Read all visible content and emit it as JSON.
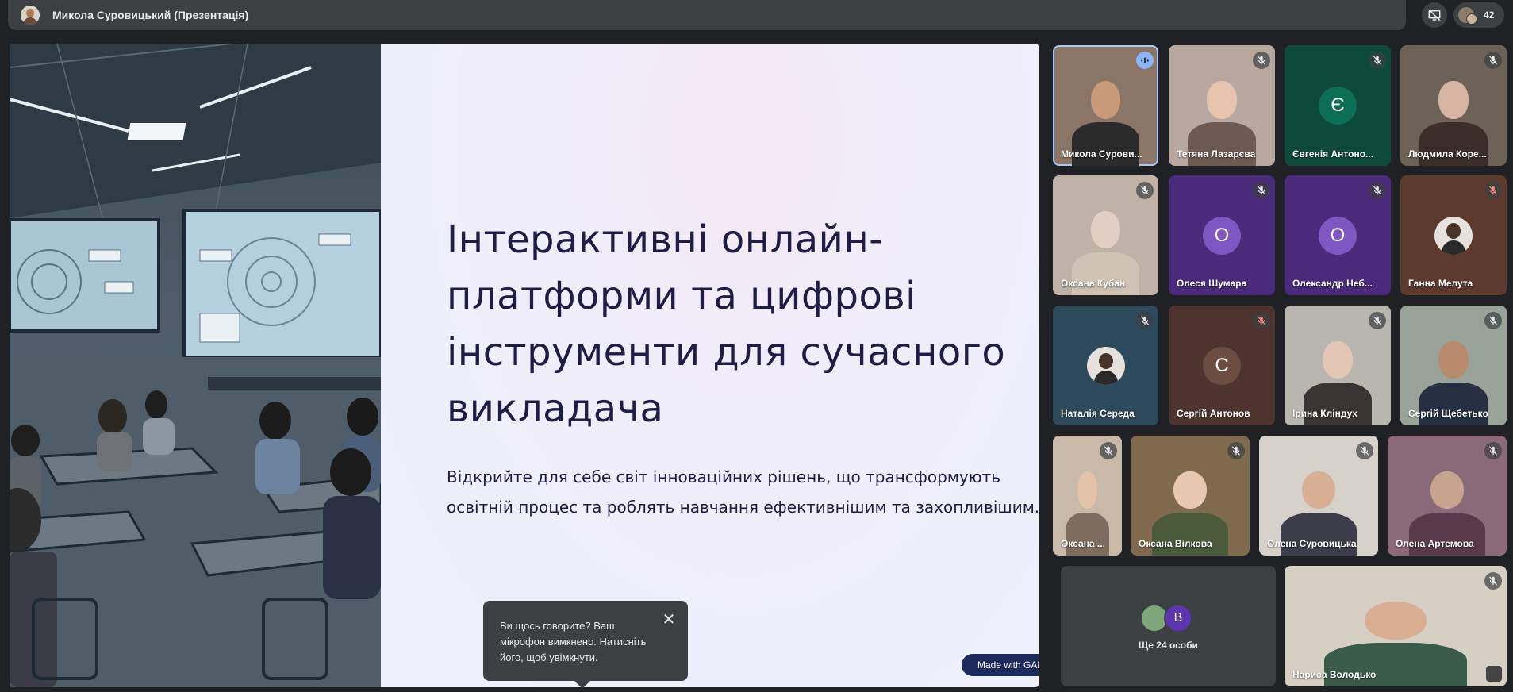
{
  "header": {
    "presenter_title": "Микола Суровицький (Презентація)",
    "participant_count": "42"
  },
  "slide": {
    "title_lines": [
      "Інтерактивні онлайн-",
      "платформи та цифрові",
      "інструменти для сучасного",
      "викладача"
    ],
    "subtitle_lines": [
      "Відкрийте для себе світ інноваційних рішень, що трансформують",
      "освітній процес та роблять навчання ефективнішим та захопливішим."
    ],
    "made_with": "Made with GAMMA"
  },
  "tooltip": {
    "text": "Ви щось говорите? Ваш мікрофон вимкнено. Натисніть його, щоб увімкнути."
  },
  "participants": [
    {
      "name": "Микола Сурови...",
      "type": "video",
      "mic": "speaking",
      "skin": "#c89a78",
      "body": "#2b2b2b",
      "bg": "#8a7566"
    },
    {
      "name": "Тетяна Лазарєва",
      "type": "video",
      "mic": "muted",
      "skin": "#e6c3ac",
      "body": "#6f5a52",
      "bg": "#b8a8a0"
    },
    {
      "name": "Євгенія Антоно...",
      "type": "letter",
      "letter": "Є",
      "mic": "muted",
      "avatar_color": "#0d6e56",
      "bg": "#0e4a3c"
    },
    {
      "name": "Людмила Коре...",
      "type": "video",
      "mic": "muted",
      "skin": "#d7b4a1",
      "body": "#3a2d2a",
      "bg": "#6d6258"
    },
    {
      "name": "Оксана Кубан",
      "type": "video",
      "mic": "muted",
      "skin": "#e0cfc2",
      "body": "#cfc3b5",
      "bg": "#bfb2a6"
    },
    {
      "name": "Олеся Шумара",
      "type": "letter",
      "letter": "О",
      "mic": "muted",
      "avatar_color": "#7e57c2",
      "bg": "#4a2a7a"
    },
    {
      "name": "Олександр Неб...",
      "type": "letter",
      "letter": "О",
      "mic": "muted",
      "avatar_color": "#7e57c2",
      "bg": "#4a2a7a"
    },
    {
      "name": "Ганна Мелута",
      "type": "photo",
      "mic": "muted-red",
      "bg": "#5d3a2e"
    },
    {
      "name": "Наталія Середа",
      "type": "photo",
      "mic": "muted",
      "bg": "#2d4a5a"
    },
    {
      "name": "Сергій Антонов",
      "type": "letter",
      "letter": "С",
      "mic": "muted-red",
      "avatar_color": "#6d4c41",
      "bg": "#4e342e"
    },
    {
      "name": "Ірина Кліндух",
      "type": "video",
      "mic": "muted",
      "skin": "#e4c6b5",
      "body": "#3b3434",
      "bg": "#b9b6b0"
    },
    {
      "name": "Сергій Щебетько",
      "type": "video",
      "mic": "muted",
      "skin": "#b88a6e",
      "body": "#263042",
      "bg": "#9aa39a"
    },
    {
      "name": "Оксана ...",
      "type": "video",
      "mic": "muted",
      "skin": "#e2c2a8",
      "body": "#7d6d60",
      "bg": "#c9b9a8"
    },
    {
      "name": "Оксана Вілкова",
      "type": "video",
      "mic": "muted",
      "skin": "#e8c8b0",
      "body": "#4a5a3a",
      "bg": "#7f6a4e"
    },
    {
      "name": "Олена Суровицька",
      "type": "video",
      "mic": "muted",
      "skin": "#d8b096",
      "body": "#3d3d4a",
      "bg": "#d6d2cb"
    },
    {
      "name": "Олена Артемова",
      "type": "video",
      "mic": "muted",
      "skin": "#c8a48e",
      "body": "#5a3a4a",
      "bg": "#8a6a78"
    },
    {
      "name": "Нариса Володько",
      "type": "video",
      "mic": "muted",
      "skin": "#d9ae92",
      "body": "#3a5a4a",
      "bg": "#d5cfc4"
    }
  ],
  "more_tile": {
    "label": "Ще 24 особи",
    "letter": "В"
  },
  "colors": {
    "background": "#202124",
    "bar": "#3c4043",
    "speaking": "#8ab4f8",
    "slide_text": "#1f1d45"
  }
}
